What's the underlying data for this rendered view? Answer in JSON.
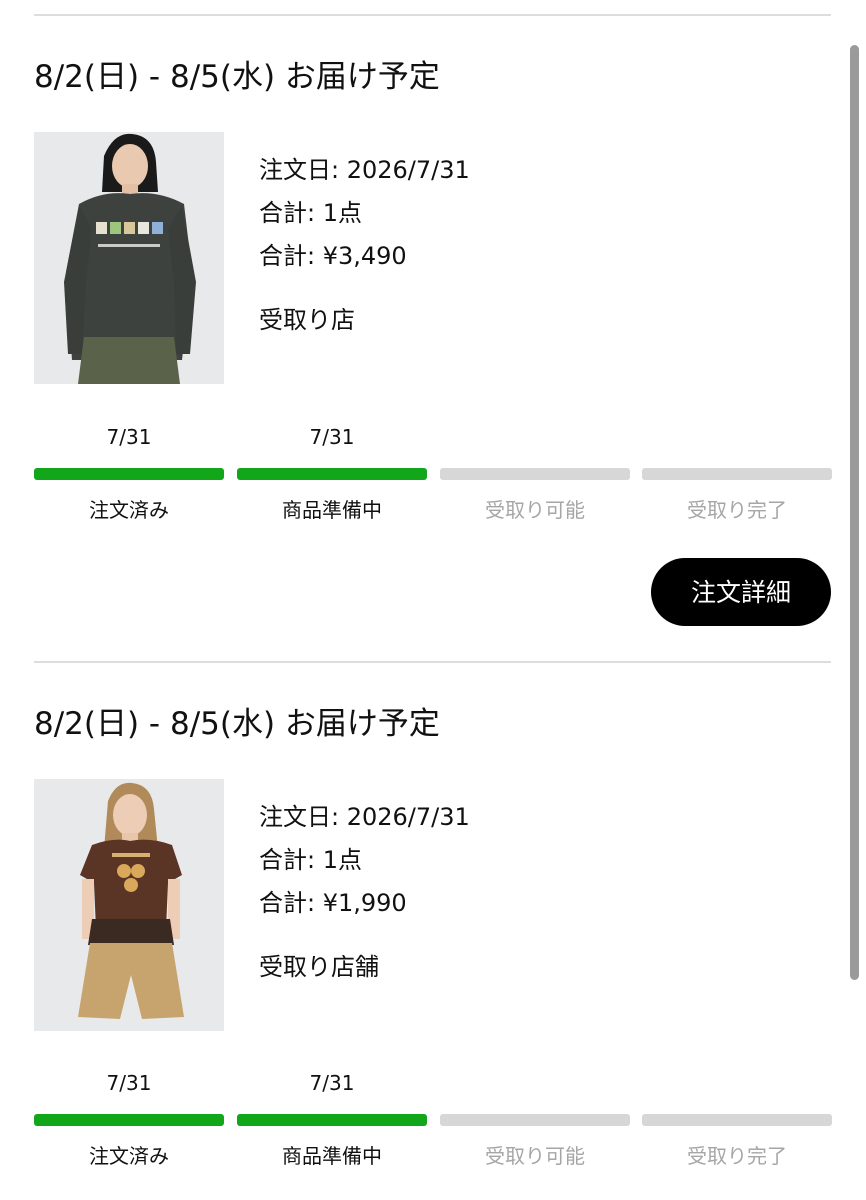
{
  "colors": {
    "done": "#12a71a",
    "pending": "#d7d7d7",
    "done_text": "#111111",
    "pending_text": "#a6a6a6",
    "button_bg": "#000000"
  },
  "orders": [
    {
      "delivery": "8/2(日) - 8/5(水) お届け予定",
      "order_date": "注文日: 2026/7/31",
      "quantity": "合計: 1点",
      "total": "合計: ¥3,490",
      "store": "受取り店",
      "image_icon": "product-photo-sweatshirt",
      "steps": [
        {
          "label": "注文済み",
          "date": "7/31",
          "done": true
        },
        {
          "label": "商品準備中",
          "date": "7/31",
          "done": true
        },
        {
          "label": "受取り可能",
          "date": "",
          "done": false
        },
        {
          "label": "受取り完了",
          "date": "",
          "done": false
        }
      ],
      "detail_button": "注文詳細"
    },
    {
      "delivery": "8/2(日) - 8/5(水) お届け予定",
      "order_date": "注文日: 2026/7/31",
      "quantity": "合計: 1点",
      "total": "合計: ¥1,990",
      "store": "受取り店舗",
      "image_icon": "product-photo-tshirt",
      "steps": [
        {
          "label": "注文済み",
          "date": "7/31",
          "done": true
        },
        {
          "label": "商品準備中",
          "date": "7/31",
          "done": true
        },
        {
          "label": "受取り可能",
          "date": "",
          "done": false
        },
        {
          "label": "受取り完了",
          "date": "",
          "done": false
        }
      ]
    }
  ]
}
